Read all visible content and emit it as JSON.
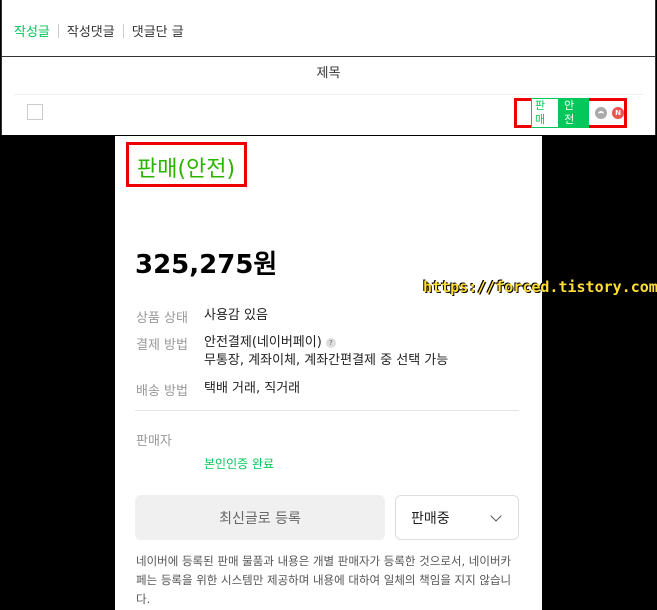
{
  "tabs": [
    {
      "label": "작성글",
      "active": true
    },
    {
      "label": "작성댓글",
      "active": false
    },
    {
      "label": "댓글단 글",
      "active": false
    }
  ],
  "list": {
    "column_title": "제목",
    "badges": {
      "sale": "판매",
      "safe": "안전"
    }
  },
  "product": {
    "status": "판매(안전)",
    "price": "325,275원",
    "info": {
      "condition_label": "상품 상태",
      "condition_value": "사용감 있음",
      "payment_label": "결제 방법",
      "payment_value_1": "안전결제(네이버페이)",
      "payment_value_2": "무통장, 계좌이체, 계좌간편결제 중 선택 가능",
      "shipping_label": "배송 방법",
      "shipping_value": "택배 거래, 직거래"
    },
    "seller_label": "판매자",
    "verified": "본인인증 완료",
    "latest_button": "최신글로 등록",
    "sale_status": "판매중",
    "disclaimer": "네이버에 등록된 판매 물품과 내용은 개별 판매자가 등록한 것으로서, 네이버카페는 등록을 위한 시스템만 제공하며 내용에 대하여 일체의 책임을 지지 않습니다."
  },
  "watermark": "https://forced.tistory.com",
  "colors": {
    "accent": "#03c75a",
    "status_green": "#2db400",
    "highlight": "#e00000"
  }
}
